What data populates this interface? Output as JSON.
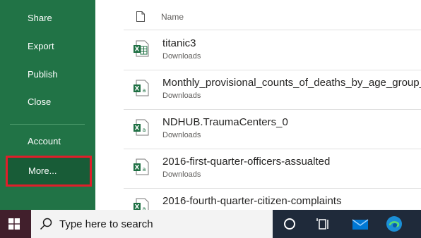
{
  "sidebar": {
    "items": [
      {
        "label": "Share"
      },
      {
        "label": "Export"
      },
      {
        "label": "Publish"
      },
      {
        "label": "Close"
      },
      {
        "label": "Account"
      },
      {
        "label": "More..."
      }
    ]
  },
  "file_list": {
    "header_name": "Name",
    "files": [
      {
        "name": "titanic3",
        "location": "Downloads"
      },
      {
        "name": "Monthly_provisional_counts_of_deaths_by_age_group__s",
        "location": "Downloads"
      },
      {
        "name": "NDHUB.TraumaCenters_0",
        "location": "Downloads"
      },
      {
        "name": "2016-first-quarter-officers-assualted",
        "location": "Downloads"
      },
      {
        "name": "2016-fourth-quarter-citizen-complaints",
        "location": ""
      }
    ]
  },
  "taskbar": {
    "search_placeholder": "Type here to search"
  },
  "colors": {
    "sidebar": "#217346",
    "highlight": "#e01e2a",
    "excel_green": "#1d6f42",
    "taskbar": "#1f2a3a"
  }
}
